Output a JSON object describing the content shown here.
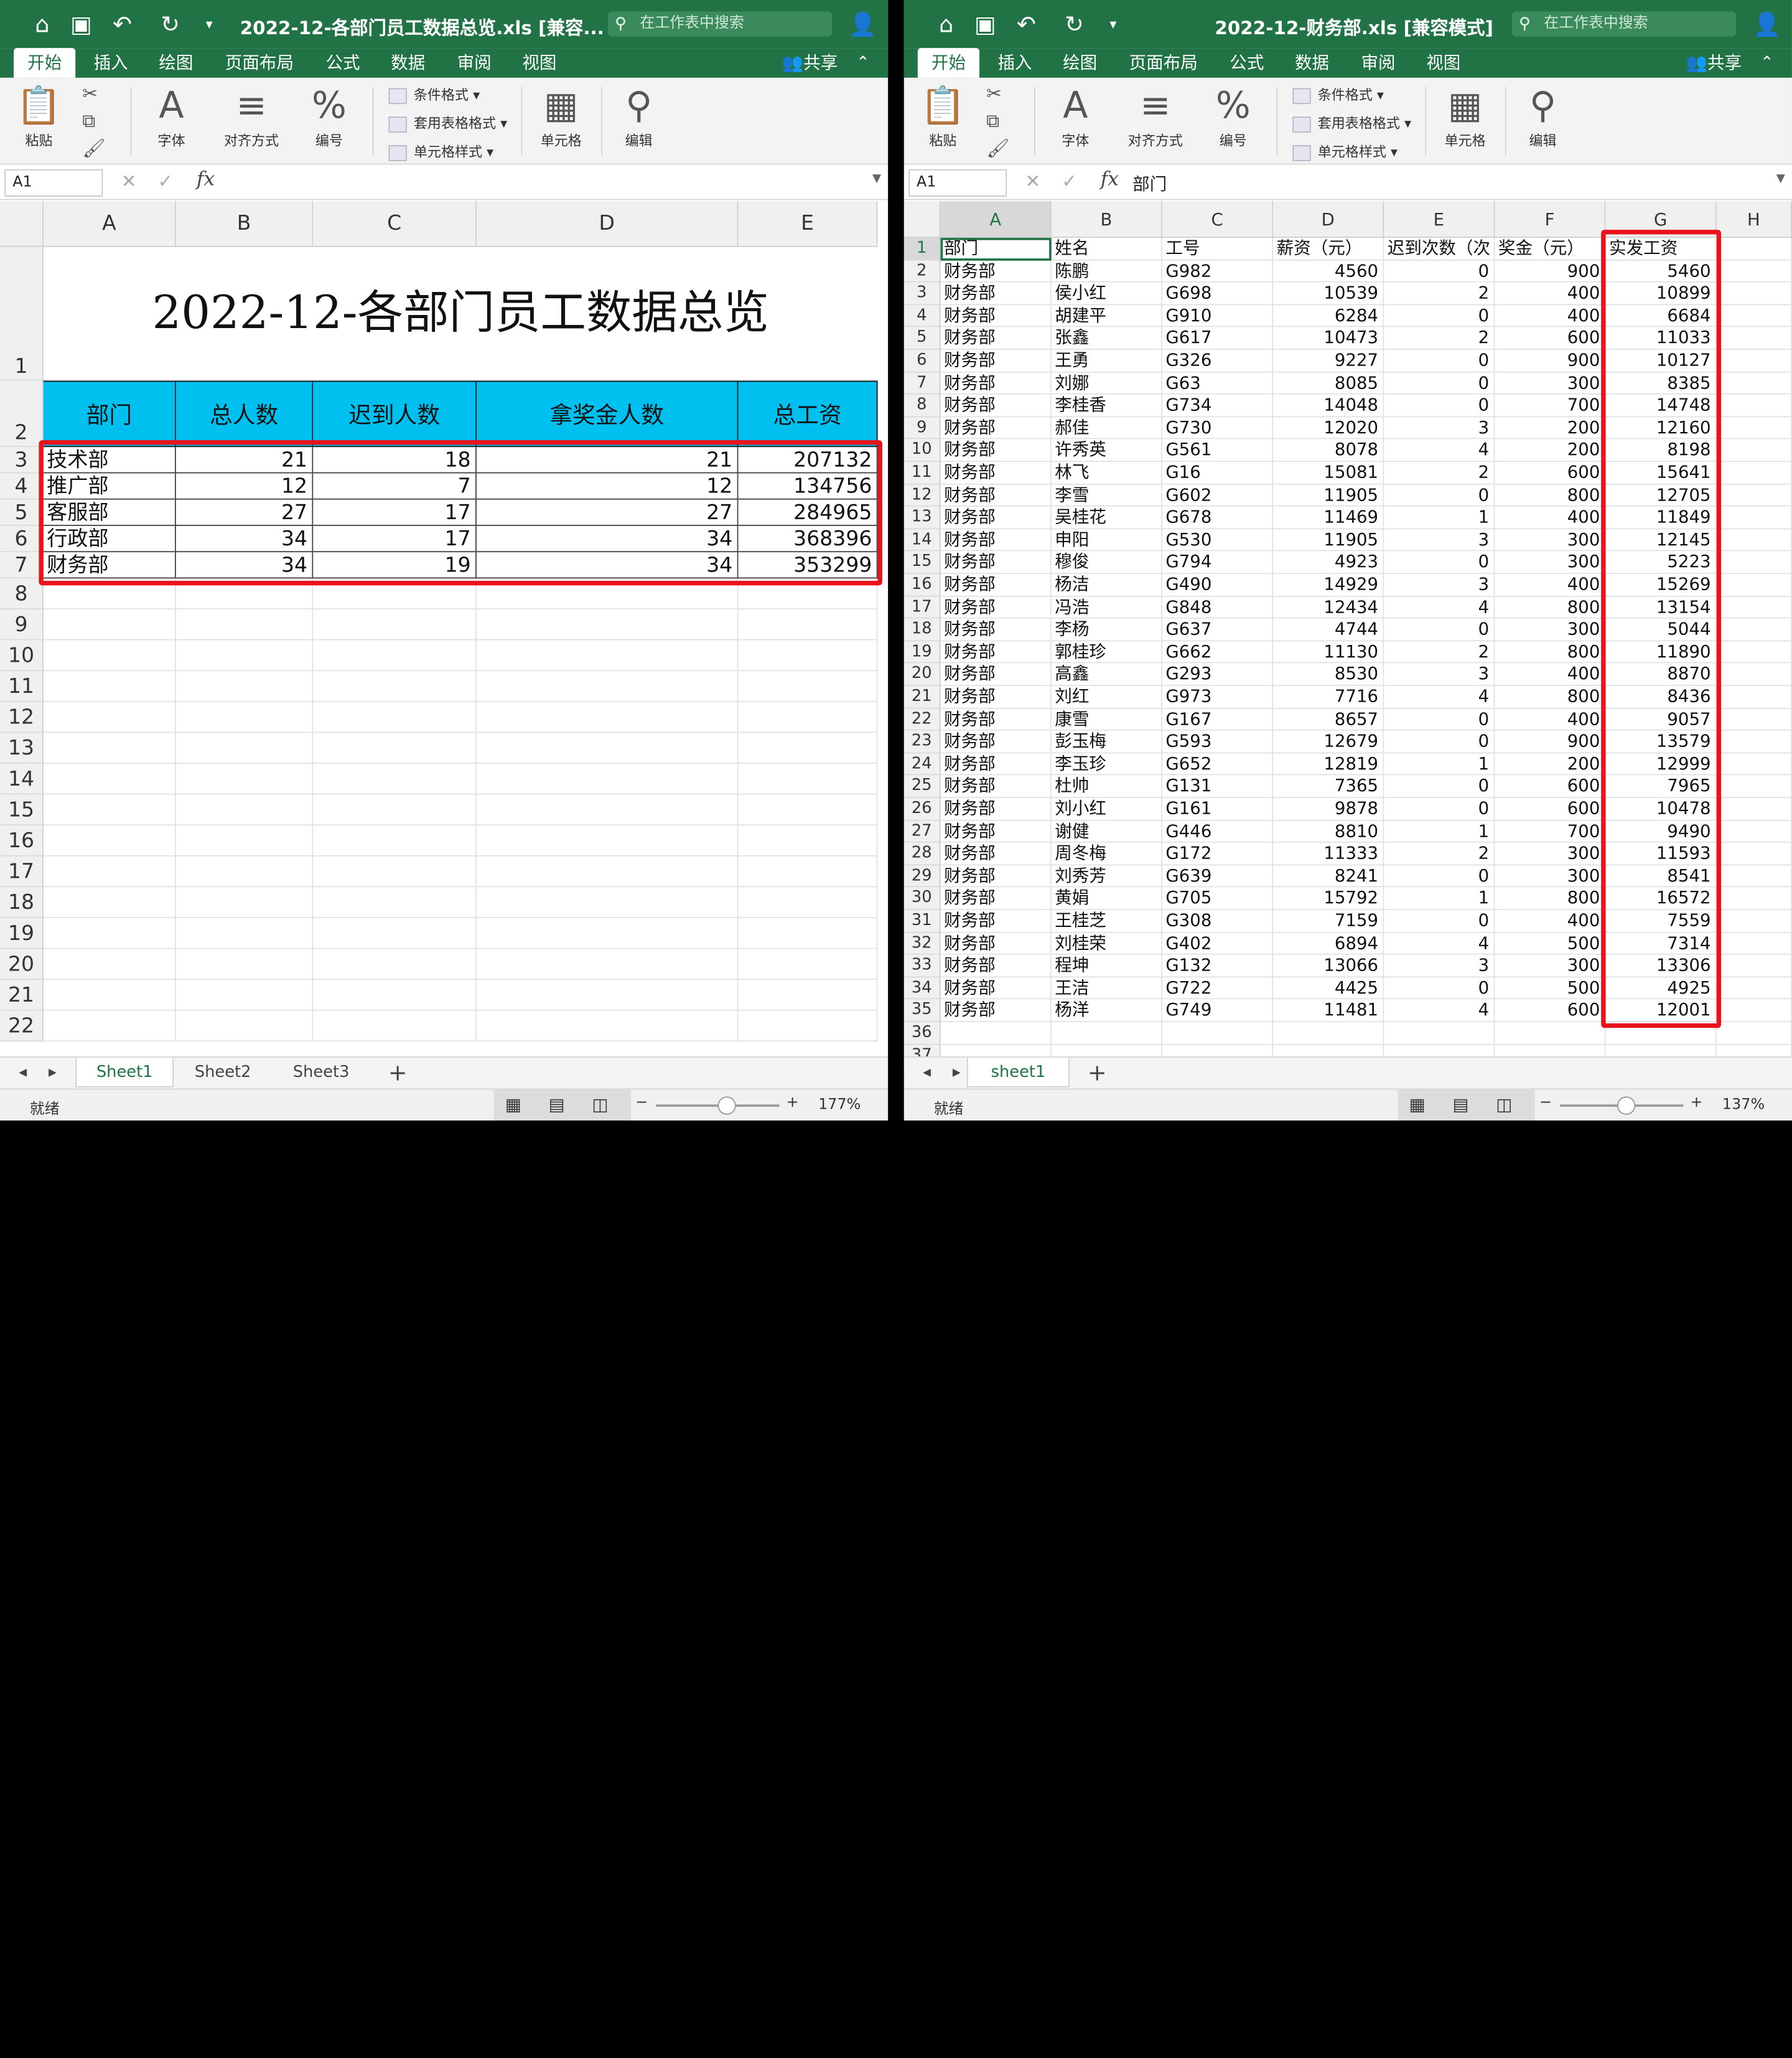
{
  "left": {
    "title": "2022-12-各部门员工数据总览.xls [兼容...",
    "search_placeholder": "在工作表中搜索",
    "tabs": [
      "开始",
      "插入",
      "绘图",
      "页面布局",
      "公式",
      "数据",
      "审阅",
      "视图"
    ],
    "share": "共享",
    "ribbon": {
      "paste": "粘贴",
      "font": "字体",
      "align": "对齐方式",
      "number": "编号",
      "cond_format": "条件格式",
      "table_format": "套用表格格式",
      "cell_style": "单元格样式",
      "cells": "单元格",
      "edit": "编辑"
    },
    "namebox": "A1",
    "formula": "",
    "columns": [
      "A",
      "B",
      "C",
      "D",
      "E"
    ],
    "sheet_title": "2022-12-各部门员工数据总览",
    "headers": [
      "部门",
      "总人数",
      "迟到人数",
      "拿奖金人数",
      "总工资"
    ],
    "rows": [
      [
        "技术部",
        "21",
        "18",
        "21",
        "207132"
      ],
      [
        "推广部",
        "12",
        "7",
        "12",
        "134756"
      ],
      [
        "客服部",
        "27",
        "17",
        "27",
        "284965"
      ],
      [
        "行政部",
        "34",
        "17",
        "34",
        "368396"
      ],
      [
        "财务部",
        "34",
        "19",
        "34",
        "353299"
      ]
    ],
    "row_numbers": [
      "1",
      "2",
      "3",
      "4",
      "5",
      "6",
      "7",
      "8",
      "9",
      "10",
      "11",
      "12",
      "13",
      "14",
      "15",
      "16",
      "17",
      "18",
      "19",
      "20",
      "21",
      "22"
    ],
    "sheets": [
      "Sheet1",
      "Sheet2",
      "Sheet3"
    ],
    "status": "就绪",
    "zoom": "177%"
  },
  "right": {
    "title": "2022-12-财务部.xls [兼容模式]",
    "search_placeholder": "在工作表中搜索",
    "tabs": [
      "开始",
      "插入",
      "绘图",
      "页面布局",
      "公式",
      "数据",
      "审阅",
      "视图"
    ],
    "share": "共享",
    "ribbon": {
      "paste": "粘贴",
      "font": "字体",
      "align": "对齐方式",
      "number": "编号",
      "cond_format": "条件格式",
      "table_format": "套用表格格式",
      "cell_style": "单元格样式",
      "cells": "单元格",
      "edit": "编辑"
    },
    "namebox": "A1",
    "formula": "部门",
    "columns": [
      "A",
      "B",
      "C",
      "D",
      "E",
      "F",
      "G",
      "H"
    ],
    "headers": [
      "部门",
      "姓名",
      "工号",
      "薪资（元）",
      "迟到次数（次",
      "奖金（元）",
      "实发工资"
    ],
    "rows": [
      [
        "财务部",
        "陈鹏",
        "G982",
        "4560",
        "0",
        "900",
        "5460"
      ],
      [
        "财务部",
        "侯小红",
        "G698",
        "10539",
        "2",
        "400",
        "10899"
      ],
      [
        "财务部",
        "胡建平",
        "G910",
        "6284",
        "0",
        "400",
        "6684"
      ],
      [
        "财务部",
        "张鑫",
        "G617",
        "10473",
        "2",
        "600",
        "11033"
      ],
      [
        "财务部",
        "王勇",
        "G326",
        "9227",
        "0",
        "900",
        "10127"
      ],
      [
        "财务部",
        "刘娜",
        "G63",
        "8085",
        "0",
        "300",
        "8385"
      ],
      [
        "财务部",
        "李桂香",
        "G734",
        "14048",
        "0",
        "700",
        "14748"
      ],
      [
        "财务部",
        "郝佳",
        "G730",
        "12020",
        "3",
        "200",
        "12160"
      ],
      [
        "财务部",
        "许秀英",
        "G561",
        "8078",
        "4",
        "200",
        "8198"
      ],
      [
        "财务部",
        "林飞",
        "G16",
        "15081",
        "2",
        "600",
        "15641"
      ],
      [
        "财务部",
        "李雪",
        "G602",
        "11905",
        "0",
        "800",
        "12705"
      ],
      [
        "财务部",
        "吴桂花",
        "G678",
        "11469",
        "1",
        "400",
        "11849"
      ],
      [
        "财务部",
        "申阳",
        "G530",
        "11905",
        "3",
        "300",
        "12145"
      ],
      [
        "财务部",
        "穆俊",
        "G794",
        "4923",
        "0",
        "300",
        "5223"
      ],
      [
        "财务部",
        "杨洁",
        "G490",
        "14929",
        "3",
        "400",
        "15269"
      ],
      [
        "财务部",
        "冯浩",
        "G848",
        "12434",
        "4",
        "800",
        "13154"
      ],
      [
        "财务部",
        "李杨",
        "G637",
        "4744",
        "0",
        "300",
        "5044"
      ],
      [
        "财务部",
        "郭桂珍",
        "G662",
        "11130",
        "2",
        "800",
        "11890"
      ],
      [
        "财务部",
        "高鑫",
        "G293",
        "8530",
        "3",
        "400",
        "8870"
      ],
      [
        "财务部",
        "刘红",
        "G973",
        "7716",
        "4",
        "800",
        "8436"
      ],
      [
        "财务部",
        "康雪",
        "G167",
        "8657",
        "0",
        "400",
        "9057"
      ],
      [
        "财务部",
        "彭玉梅",
        "G593",
        "12679",
        "0",
        "900",
        "13579"
      ],
      [
        "财务部",
        "李玉珍",
        "G652",
        "12819",
        "1",
        "200",
        "12999"
      ],
      [
        "财务部",
        "杜帅",
        "G131",
        "7365",
        "0",
        "600",
        "7965"
      ],
      [
        "财务部",
        "刘小红",
        "G161",
        "9878",
        "0",
        "600",
        "10478"
      ],
      [
        "财务部",
        "谢健",
        "G446",
        "8810",
        "1",
        "700",
        "9490"
      ],
      [
        "财务部",
        "周冬梅",
        "G172",
        "11333",
        "2",
        "300",
        "11593"
      ],
      [
        "财务部",
        "刘秀芳",
        "G639",
        "8241",
        "0",
        "300",
        "8541"
      ],
      [
        "财务部",
        "黄娟",
        "G705",
        "15792",
        "1",
        "800",
        "16572"
      ],
      [
        "财务部",
        "王桂芝",
        "G308",
        "7159",
        "0",
        "400",
        "7559"
      ],
      [
        "财务部",
        "刘桂荣",
        "G402",
        "6894",
        "4",
        "500",
        "7314"
      ],
      [
        "财务部",
        "程坤",
        "G132",
        "13066",
        "3",
        "300",
        "13306"
      ],
      [
        "财务部",
        "王洁",
        "G722",
        "4425",
        "0",
        "500",
        "4925"
      ],
      [
        "财务部",
        "杨洋",
        "G749",
        "11481",
        "4",
        "600",
        "12001"
      ]
    ],
    "row_numbers": [
      "1",
      "2",
      "3",
      "4",
      "5",
      "6",
      "7",
      "8",
      "9",
      "10",
      "11",
      "12",
      "13",
      "14",
      "15",
      "16",
      "17",
      "18",
      "19",
      "20",
      "21",
      "22",
      "23",
      "24",
      "25",
      "26",
      "27",
      "28",
      "29",
      "30",
      "31",
      "32",
      "33",
      "34",
      "35",
      "36",
      "37"
    ],
    "sheets": [
      "sheet1"
    ],
    "status": "就绪",
    "zoom": "137%"
  },
  "colors": {
    "excel_green": "#217346",
    "header_fill": "#00c0f0",
    "highlight_red": "#e8131b"
  },
  "icons": [
    "home-icon",
    "save-icon",
    "undo-icon",
    "redo-icon",
    "search-icon",
    "share-person-icon",
    "paste-icon",
    "cut-icon",
    "copy-icon",
    "format-painter-icon",
    "font-icon",
    "align-icon",
    "percent-icon",
    "cells-icon",
    "find-icon"
  ]
}
